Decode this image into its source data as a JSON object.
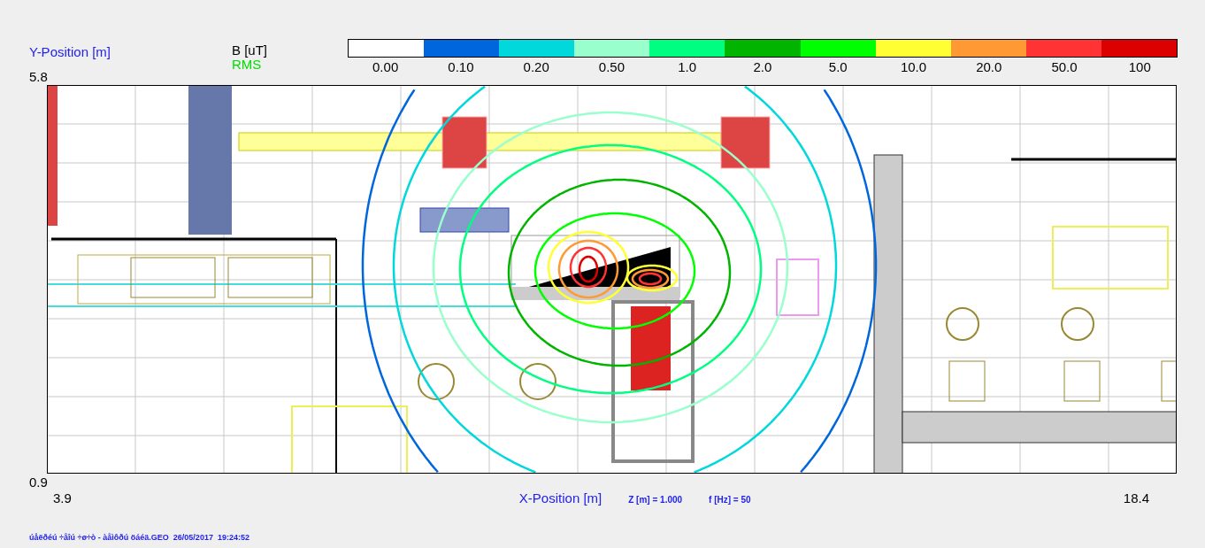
{
  "y_axis": {
    "label": "Y-Position [m]",
    "max": "5.8",
    "min": "0.9"
  },
  "quantity": {
    "label": "B [uT]",
    "mode": "RMS"
  },
  "legend": [
    {
      "label": "0.00",
      "color": "#ffffff"
    },
    {
      "label": "0.10",
      "color": "#0066dd"
    },
    {
      "label": "0.20",
      "color": "#00d8dc"
    },
    {
      "label": "0.50",
      "color": "#99ffcc"
    },
    {
      "label": "1.0",
      "color": "#00ff80"
    },
    {
      "label": "2.0",
      "color": "#00b400"
    },
    {
      "label": "5.0",
      "color": "#00ff00"
    },
    {
      "label": "10.0",
      "color": "#ffff33"
    },
    {
      "label": "20.0",
      "color": "#ff9933"
    },
    {
      "label": "50.0",
      "color": "#ff3333"
    },
    {
      "label": "100",
      "color": "#dd0000"
    }
  ],
  "x_axis": {
    "label": "X-Position [m]",
    "min": "3.9",
    "max": "18.4"
  },
  "parameters": [
    "Z [m] = 1.000",
    "f [Hz] = 50"
  ],
  "footer": "úåëðéú ÷åîú ÷ø÷ò - àåìôðú öáéä.GEO  26/05/2017  19:24:52"
}
